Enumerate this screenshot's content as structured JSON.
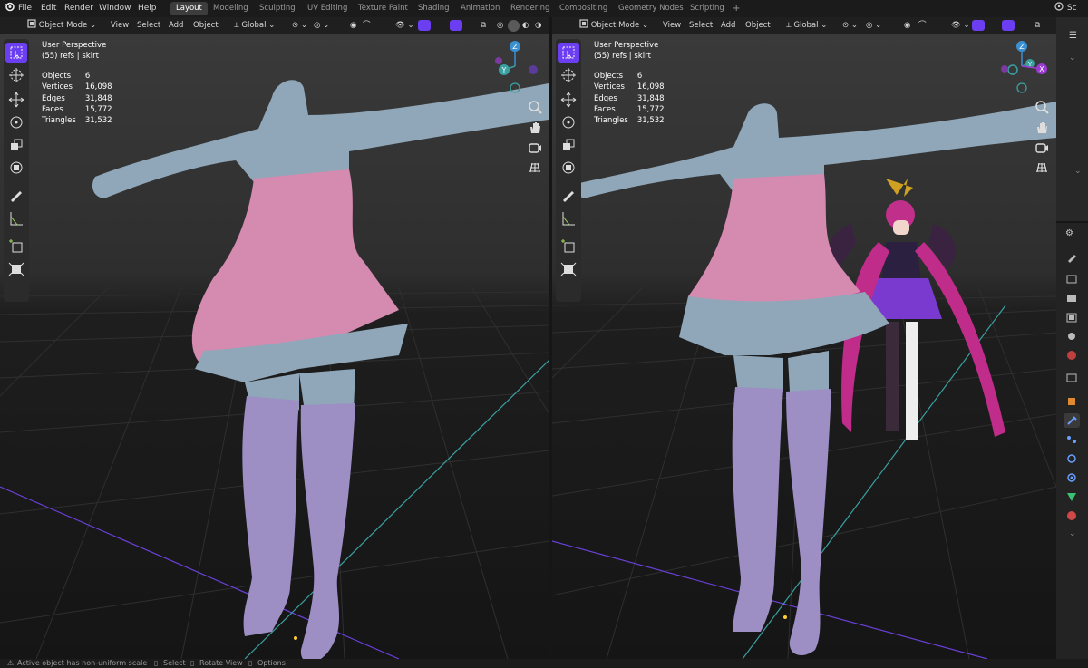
{
  "app": {
    "logo": "blender-logo-icon"
  },
  "menu": [
    "File",
    "Edit",
    "Render",
    "Window",
    "Help"
  ],
  "workspaces": [
    {
      "label": "Layout",
      "active": true
    },
    {
      "label": "Modeling"
    },
    {
      "label": "Sculpting"
    },
    {
      "label": "UV Editing"
    },
    {
      "label": "Texture Paint"
    },
    {
      "label": "Shading"
    },
    {
      "label": "Animation"
    },
    {
      "label": "Rendering"
    },
    {
      "label": "Compositing"
    },
    {
      "label": "Geometry Nodes"
    },
    {
      "label": "Scripting"
    }
  ],
  "add_workspace": "+",
  "scene_label": "Sc",
  "viewport_header": {
    "mode": "Object Mode",
    "menus": [
      "View",
      "Select",
      "Add",
      "Object"
    ],
    "transform_orientation": "Global"
  },
  "viewports": {
    "left": {
      "perspective": "User Perspective",
      "collection": "(55) refs | skirt",
      "stats": [
        {
          "label": "Objects",
          "value": "6"
        },
        {
          "label": "Vertices",
          "value": "16,098"
        },
        {
          "label": "Edges",
          "value": "31,848"
        },
        {
          "label": "Faces",
          "value": "15,772"
        },
        {
          "label": "Triangles",
          "value": "31,532"
        }
      ]
    },
    "right": {
      "perspective": "User Perspective",
      "collection": "(55) refs | skirt",
      "stats": [
        {
          "label": "Objects",
          "value": "6"
        },
        {
          "label": "Vertices",
          "value": "16,098"
        },
        {
          "label": "Edges",
          "value": "31,848"
        },
        {
          "label": "Faces",
          "value": "15,772"
        },
        {
          "label": "Triangles",
          "value": "31,532"
        }
      ]
    }
  },
  "gizmo_axes": {
    "x": "X",
    "y": "Y",
    "z": "Z"
  },
  "tools": [
    "select-box-icon",
    "cursor-icon",
    "move-icon",
    "rotate-icon",
    "scale-icon",
    "transform-icon",
    "annotate-icon",
    "measure-icon",
    "add-cube-icon",
    "uv-icon"
  ],
  "statusbar": {
    "warning": "Active object has non-uniform scale",
    "select": "Select",
    "rotate": "Rotate View",
    "options": "Options"
  },
  "colors": {
    "accent": "#6b3ef2",
    "body": "#8fa7b8",
    "dress": "#d58bb0",
    "stockings": "#9d8ec4",
    "background": "#2a2a2a",
    "x_axis": "#e04060",
    "y_axis": "#3aa0a0"
  }
}
